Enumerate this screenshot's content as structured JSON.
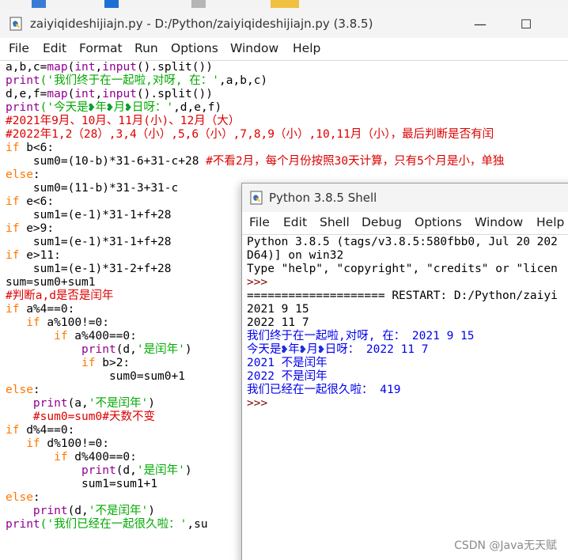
{
  "editor": {
    "title": "zaiyiqideshijiajn.py - D:/Python/zaiyiqideshijiajn.py (3.8.5)",
    "menu": [
      "File",
      "Edit",
      "Format",
      "Run",
      "Options",
      "Window",
      "Help"
    ],
    "minimize_label": "—",
    "maximize_label": "☐",
    "lines": [
      [
        [
          "t",
          "a,b,c="
        ],
        [
          "bi",
          "map"
        ],
        [
          "t",
          "("
        ],
        [
          "bi",
          "int"
        ],
        [
          "t",
          ","
        ],
        [
          "bi",
          "input"
        ],
        [
          "t",
          "().split())"
        ]
      ],
      [
        [
          "bi",
          "print"
        ],
        [
          "str",
          "('我们终于在一起啦,对呀, 在：'"
        ],
        [
          "t",
          ",a,b,c)"
        ]
      ],
      [
        [
          "t",
          "d,e,f="
        ],
        [
          "bi",
          "map"
        ],
        [
          "t",
          "("
        ],
        [
          "bi",
          "int"
        ],
        [
          "t",
          ","
        ],
        [
          "bi",
          "input"
        ],
        [
          "t",
          "().split())"
        ]
      ],
      [
        [
          "bi",
          "print"
        ],
        [
          "str",
          "('今天是"
        ],
        [
          "heart",
          "❥"
        ],
        [
          "str",
          "年"
        ],
        [
          "heart",
          "❥"
        ],
        [
          "str",
          "月"
        ],
        [
          "heart",
          "❥"
        ],
        [
          "str",
          "日呀：'"
        ],
        [
          "t",
          ",d,e,f)"
        ]
      ],
      [
        [
          "cm",
          "#2021年9月、10月、11月(小)、12月（大）"
        ]
      ],
      [
        [
          "cm",
          "#2022年1,2（28）,3,4（小）,5,6（小）,7,8,9（小）,10,11月（小），最后判断是否有闰"
        ]
      ],
      [
        [
          "kw",
          "if"
        ],
        [
          "t",
          " b<6:"
        ]
      ],
      [
        [
          "t",
          "    sum0=(10-b)*31-6+31-c+28 "
        ],
        [
          "cm",
          "#不看2月，每个月份按照30天计算，只有5个月是小，单独"
        ]
      ],
      [
        [
          "kw",
          "else"
        ],
        [
          "t",
          ":"
        ]
      ],
      [
        [
          "t",
          "    sum0=(11-b)*31-3+31-c"
        ]
      ],
      [
        [
          "kw",
          "if"
        ],
        [
          "t",
          " e<6:"
        ]
      ],
      [
        [
          "t",
          "    sum1=(e-1)*31-1+f+28"
        ]
      ],
      [
        [
          "kw",
          "if"
        ],
        [
          "t",
          " e>9:"
        ]
      ],
      [
        [
          "t",
          "    sum1=(e-1)*31-1+f+28"
        ]
      ],
      [
        [
          "kw",
          "if"
        ],
        [
          "t",
          " e>11:"
        ]
      ],
      [
        [
          "t",
          "    sum1=(e-1)*31-2+f+28"
        ]
      ],
      [
        [
          "t",
          "sum=sum0+sum1"
        ]
      ],
      [
        [
          "cm",
          "#判断a,d是否是闰年"
        ]
      ],
      [
        [
          "kw",
          "if"
        ],
        [
          "t",
          " a%4==0:"
        ]
      ],
      [
        [
          "t",
          "   "
        ],
        [
          "kw",
          "if"
        ],
        [
          "t",
          " a%100!=0:"
        ]
      ],
      [
        [
          "t",
          "       "
        ],
        [
          "kw",
          "if"
        ],
        [
          "t",
          " a%400==0:"
        ]
      ],
      [
        [
          "t",
          "           "
        ],
        [
          "bi",
          "print"
        ],
        [
          "t",
          "(d,"
        ],
        [
          "str",
          "'是闰年'"
        ],
        [
          "t",
          ")"
        ]
      ],
      [
        [
          "t",
          "           "
        ],
        [
          "kw",
          "if"
        ],
        [
          "t",
          " b>2:"
        ]
      ],
      [
        [
          "t",
          "               sum0=sum0+1"
        ]
      ],
      [
        [
          "kw",
          "else"
        ],
        [
          "t",
          ":"
        ]
      ],
      [
        [
          "t",
          "    "
        ],
        [
          "bi",
          "print"
        ],
        [
          "t",
          "(a,"
        ],
        [
          "str",
          "'不是闰年'"
        ],
        [
          "t",
          ")"
        ]
      ],
      [
        [
          "t",
          "    "
        ],
        [
          "cm",
          "#sum0=sum0#天数不变"
        ]
      ],
      [
        [
          "kw",
          "if"
        ],
        [
          "t",
          " d%4==0:"
        ]
      ],
      [
        [
          "t",
          "   "
        ],
        [
          "kw",
          "if"
        ],
        [
          "t",
          " d%100!=0:"
        ]
      ],
      [
        [
          "t",
          "       "
        ],
        [
          "kw",
          "if"
        ],
        [
          "t",
          " d%400==0:"
        ]
      ],
      [
        [
          "t",
          "           "
        ],
        [
          "bi",
          "print"
        ],
        [
          "t",
          "(d,"
        ],
        [
          "str",
          "'是闰年'"
        ],
        [
          "t",
          ")"
        ]
      ],
      [
        [
          "t",
          "           sum1=sum1+1"
        ]
      ],
      [
        [
          "kw",
          "else"
        ],
        [
          "t",
          ":"
        ]
      ],
      [
        [
          "t",
          "    "
        ],
        [
          "bi",
          "print"
        ],
        [
          "t",
          "(d,"
        ],
        [
          "str",
          "'不是闰年'"
        ],
        [
          "t",
          ")"
        ]
      ],
      [
        [
          "bi",
          "print"
        ],
        [
          "str",
          "('我们已经在一起很久啦：'"
        ],
        [
          "t",
          ",su"
        ]
      ]
    ]
  },
  "shell": {
    "title": "Python 3.8.5 Shell",
    "menu": [
      "File",
      "Edit",
      "Shell",
      "Debug",
      "Options",
      "Window",
      "Help"
    ],
    "lines": [
      [
        [
          "t",
          "Python 3.8.5 (tags/v3.8.5:580fbb0, Jul 20 202"
        ]
      ],
      [
        [
          "t",
          "D64)] on win32"
        ]
      ],
      [
        [
          "t",
          "Type \"help\", \"copyright\", \"credits\" or \"licen"
        ]
      ],
      [
        [
          "prompt",
          ">>> "
        ]
      ],
      [
        [
          "t",
          "==================== RESTART: D:/Python/zaiyi"
        ]
      ],
      [
        [
          "t",
          "2021 9 15"
        ]
      ],
      [
        [
          "t",
          "2022 11 7"
        ]
      ],
      [
        [
          "blue",
          "我们终于在一起啦,对呀, 在： 2021 9 15"
        ]
      ],
      [
        [
          "blue",
          "今天是"
        ],
        [
          "hb",
          "❥"
        ],
        [
          "blue",
          "年"
        ],
        [
          "hb",
          "❥"
        ],
        [
          "blue",
          "月"
        ],
        [
          "hb",
          "❥"
        ],
        [
          "blue",
          "日呀： 2022 11 7"
        ]
      ],
      [
        [
          "blue",
          "2021 不是闰年"
        ]
      ],
      [
        [
          "blue",
          "2022 不是闰年"
        ]
      ],
      [
        [
          "blue",
          "我们已经在一起很久啦： 419"
        ]
      ],
      [
        [
          "prompt",
          ">>> "
        ]
      ]
    ]
  },
  "watermark": "CSDN @Java无天赋"
}
